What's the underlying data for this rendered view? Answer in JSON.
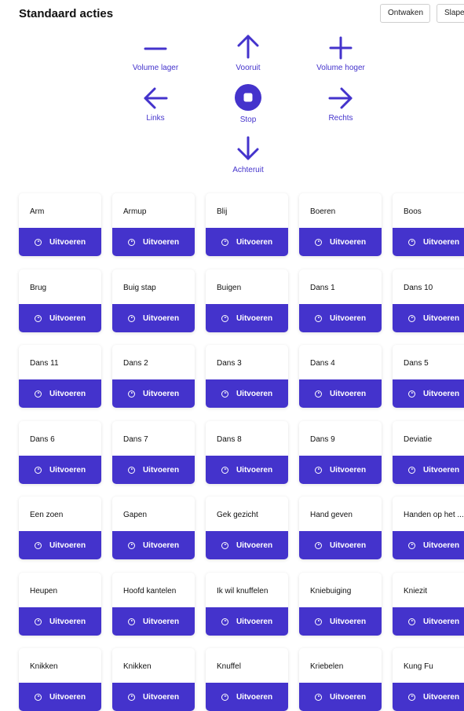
{
  "header": {
    "title": "Standaard acties",
    "wake_label": "Ontwaken",
    "sleep_label": "Slapen"
  },
  "controls": {
    "volume_down": "Volume lager",
    "forward": "Vooruit",
    "volume_up": "Volume hoger",
    "left": "Links",
    "stop": "Stop",
    "right": "Rechts",
    "backward": "Achteruit"
  },
  "colors": {
    "accent": "#4433cc",
    "card_bg": "#ffffff"
  },
  "run_label": "Uitvoeren",
  "actions": [
    "Arm",
    "Armup",
    "Blij",
    "Boeren",
    "Boos",
    "Brug",
    "Buig stap",
    "Buigen",
    "Dans 1",
    "Dans 10",
    "Dans 11",
    "Dans 2",
    "Dans 3",
    "Dans 4",
    "Dans 5",
    "Dans 6",
    "Dans 7",
    "Dans 8",
    "Dans 9",
    "Deviatie",
    "Een zoen",
    "Gapen",
    "Gek gezicht",
    "Hand geven",
    "Handen op het ...",
    "Heupen",
    "Hoofd kantelen",
    "Ik wil knuffelen",
    "Kniebuiging",
    "Kniezit",
    "Knikken",
    "Knikken",
    "Knuffel",
    "Kriebelen",
    "Kung Fu"
  ]
}
